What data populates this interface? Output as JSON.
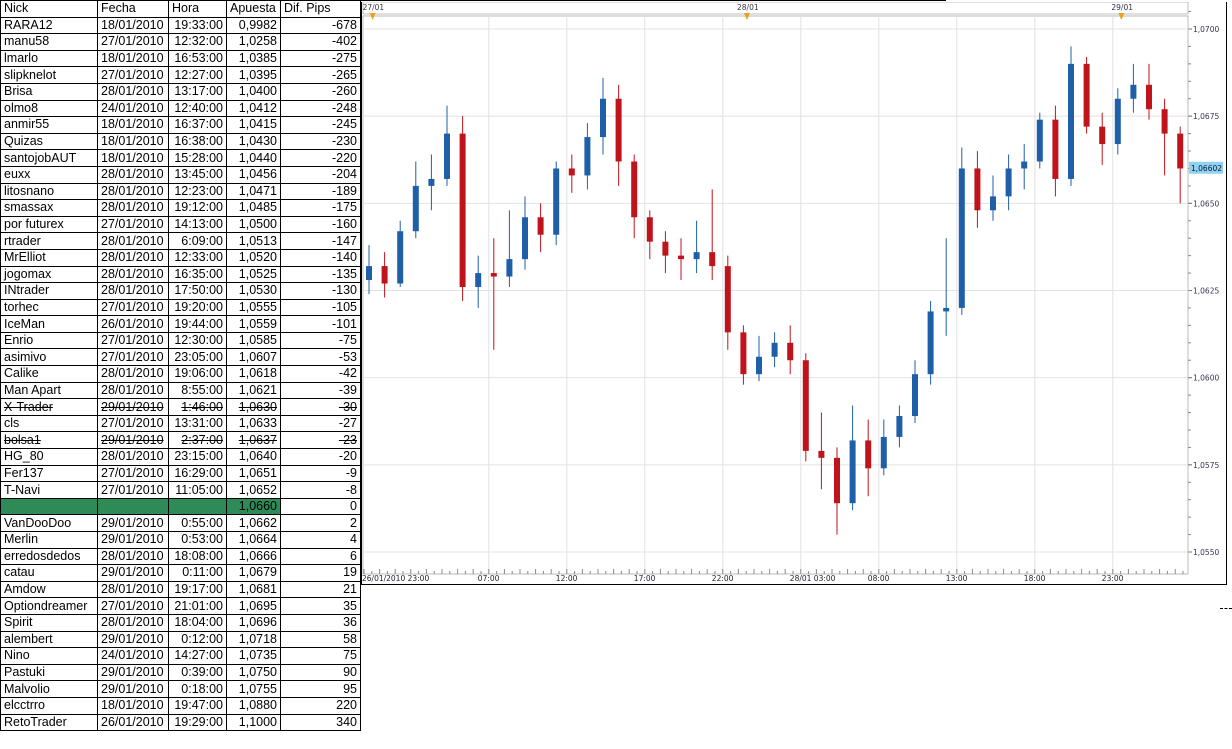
{
  "table": {
    "headers": [
      "Nick",
      "Fecha",
      "Hora",
      "Apuesta",
      "Dif. Pips"
    ],
    "rows": [
      [
        "RARA12",
        "18/01/2010",
        "19:33:00",
        "0,9982",
        "-678"
      ],
      [
        "manu58",
        "27/01/2010",
        "12:32:00",
        "1,0258",
        "-402"
      ],
      [
        "lmarlo",
        "18/01/2010",
        "16:53:00",
        "1,0385",
        "-275"
      ],
      [
        "slipknelot",
        "27/01/2010",
        "12:27:00",
        "1,0395",
        "-265"
      ],
      [
        "Brisa",
        "28/01/2010",
        "13:17:00",
        "1,0400",
        "-260"
      ],
      [
        "olmo8",
        "24/01/2010",
        "12:40:00",
        "1,0412",
        "-248"
      ],
      [
        "anmir55",
        "18/01/2010",
        "16:37:00",
        "1,0415",
        "-245"
      ],
      [
        "Quizas",
        "18/01/2010",
        "16:38:00",
        "1,0430",
        "-230"
      ],
      [
        "santojobAUT",
        "18/01/2010",
        "15:28:00",
        "1,0440",
        "-220"
      ],
      [
        "euxx",
        "28/01/2010",
        "13:45:00",
        "1,0456",
        "-204"
      ],
      [
        "litosnano",
        "28/01/2010",
        "12:23:00",
        "1,0471",
        "-189"
      ],
      [
        "smassax",
        "28/01/2010",
        "19:12:00",
        "1,0485",
        "-175"
      ],
      [
        "por futurex",
        "27/01/2010",
        "14:13:00",
        "1,0500",
        "-160"
      ],
      [
        "rtrader",
        "28/01/2010",
        "6:09:00",
        "1,0513",
        "-147"
      ],
      [
        "MrElliot",
        "28/01/2010",
        "12:33:00",
        "1,0520",
        "-140"
      ],
      [
        "jogomax",
        "28/01/2010",
        "16:35:00",
        "1,0525",
        "-135"
      ],
      [
        "INtrader",
        "28/01/2010",
        "17:50:00",
        "1,0530",
        "-130"
      ],
      [
        "torhec",
        "27/01/2010",
        "19:20:00",
        "1,0555",
        "-105"
      ],
      [
        "IceMan",
        "26/01/2010",
        "19:44:00",
        "1,0559",
        "-101"
      ],
      [
        "Enrio",
        "27/01/2010",
        "12:30:00",
        "1,0585",
        "-75"
      ],
      [
        "asimivo",
        "27/01/2010",
        "23:05:00",
        "1,0607",
        "-53"
      ],
      [
        "Calike",
        "28/01/2010",
        "19:06:00",
        "1,0618",
        "-42"
      ],
      [
        "Man Apart",
        "28/01/2010",
        "8:55:00",
        "1,0621",
        "-39"
      ],
      [
        "X-Trader",
        "29/01/2010",
        "1:46:00",
        "1,0630",
        "-30"
      ],
      [
        "cls",
        "27/01/2010",
        "13:31:00",
        "1,0633",
        "-27"
      ],
      [
        "bolsa1",
        "29/01/2010",
        "2:37:00",
        "1,0637",
        "-23"
      ],
      [
        "HG_80",
        "28/01/2010",
        "23:15:00",
        "1,0640",
        "-20"
      ],
      [
        "Fer137",
        "27/01/2010",
        "16:29:00",
        "1,0651",
        "-9"
      ],
      [
        "T-Navi",
        "27/01/2010",
        "11:05:00",
        "1,0652",
        "-8"
      ],
      [
        "",
        "",
        "",
        "1,0660",
        "0"
      ],
      [
        "VanDooDoo",
        "29/01/2010",
        "0:55:00",
        "1,0662",
        "2"
      ],
      [
        "Merlin",
        "29/01/2010",
        "0:53:00",
        "1,0664",
        "4"
      ],
      [
        "erredosdedos",
        "28/01/2010",
        "18:08:00",
        "1,0666",
        "6"
      ],
      [
        "catau",
        "29/01/2010",
        "0:11:00",
        "1,0679",
        "19"
      ],
      [
        "Amdow",
        "28/01/2010",
        "19:17:00",
        "1,0681",
        "21"
      ],
      [
        "Optiondreamer",
        "27/01/2010",
        "21:01:00",
        "1,0695",
        "35"
      ],
      [
        "Spirit",
        "28/01/2010",
        "18:04:00",
        "1,0696",
        "36"
      ],
      [
        "alembert",
        "29/01/2010",
        "0:12:00",
        "1,0718",
        "58"
      ],
      [
        "Nino",
        "24/01/2010",
        "14:27:00",
        "1,0735",
        "75"
      ],
      [
        "Pastuki",
        "29/01/2010",
        "0:39:00",
        "1,0750",
        "90"
      ],
      [
        "Malvolio",
        "29/01/2010",
        "0:18:00",
        "1,0755",
        "95"
      ],
      [
        "elcctrro",
        "18/01/2010",
        "19:47:00",
        "1,0880",
        "220"
      ],
      [
        "RetoTrader",
        "26/01/2010",
        "19:29:00",
        "1,1000",
        "340"
      ]
    ],
    "struck_rows": [
      23,
      25
    ],
    "current_row": 29,
    "dashed_after_row": 34,
    "current_color": "#2e8b57"
  },
  "chart_data": {
    "type": "candlestick",
    "title": "",
    "instrument_price_label": "1,06602",
    "last_price": 1.06602,
    "ylim": [
      1.0545,
      1.071
    ],
    "yticks": [
      1.055,
      1.0575,
      1.06,
      1.0625,
      1.065,
      1.0675,
      1.07
    ],
    "ytick_labels": [
      "1,0550",
      "1,0575",
      "1,0600",
      "1,0625",
      "1,0650",
      "1,0675",
      "1,0700"
    ],
    "xtick_labels": [
      "26/01/2010 23:00",
      "07:00",
      "12:00",
      "17:00",
      "22:00",
      "28/01 03:00",
      "08:00",
      "13:00",
      "18:00",
      "23:00"
    ],
    "xtick_hour_index": [
      0,
      8,
      13,
      18,
      23,
      28,
      33,
      38,
      43,
      48
    ],
    "day_markers": [
      {
        "label": "27/01",
        "hour_index": 1
      },
      {
        "label": "28/01",
        "hour_index": 25
      },
      {
        "label": "29/01",
        "hour_index": 49
      }
    ],
    "interval": "1h (approx.)",
    "first_open": 1.0628,
    "close": [
      1.0632,
      1.0627,
      1.0642,
      1.0655,
      1.0657,
      1.067,
      1.0626,
      1.063,
      1.0629,
      1.0634,
      1.0646,
      1.0641,
      1.066,
      1.0658,
      1.0669,
      1.068,
      1.0662,
      1.0646,
      1.0639,
      1.0635,
      1.0634,
      1.0636,
      1.0632,
      1.0613,
      1.0601,
      1.0606,
      1.061,
      1.0605,
      1.0579,
      1.0577,
      1.0564,
      1.0582,
      1.0574,
      1.0583,
      1.0589,
      1.0601,
      1.0619,
      1.062,
      1.066,
      1.0648,
      1.0652,
      1.066,
      1.0662,
      1.0674,
      1.0657,
      1.069,
      1.0672,
      1.0667,
      1.068,
      1.0684,
      1.0677,
      1.067,
      1.066
    ],
    "high": [
      1.0638,
      1.0636,
      1.0645,
      1.0662,
      1.0664,
      1.0678,
      1.0675,
      1.0635,
      1.064,
      1.0648,
      1.0652,
      1.065,
      1.0662,
      1.0664,
      1.0673,
      1.0686,
      1.0684,
      1.0664,
      1.0648,
      1.0642,
      1.064,
      1.0645,
      1.0654,
      1.0635,
      1.0615,
      1.0612,
      1.0613,
      1.0615,
      1.0607,
      1.059,
      1.058,
      1.0592,
      1.0588,
      1.0588,
      1.0592,
      1.0605,
      1.0622,
      1.064,
      1.0666,
      1.0665,
      1.0658,
      1.0664,
      1.0667,
      1.0676,
      1.0678,
      1.0695,
      1.0692,
      1.0676,
      1.0683,
      1.069,
      1.069,
      1.068,
      1.0672
    ],
    "low": [
      1.0624,
      1.0623,
      1.0626,
      1.064,
      1.0648,
      1.0655,
      1.0622,
      1.062,
      1.0608,
      1.0626,
      1.0631,
      1.0636,
      1.0638,
      1.0653,
      1.0654,
      1.0664,
      1.0655,
      1.064,
      1.0634,
      1.063,
      1.0628,
      1.063,
      1.0628,
      1.0608,
      1.0598,
      1.0599,
      1.0603,
      1.0601,
      1.0576,
      1.0568,
      1.0555,
      1.0562,
      1.0566,
      1.0572,
      1.058,
      1.0587,
      1.0598,
      1.0612,
      1.0618,
      1.0643,
      1.0645,
      1.0648,
      1.0654,
      1.066,
      1.0652,
      1.0655,
      1.067,
      1.0661,
      1.0664,
      1.0676,
      1.0674,
      1.0658,
      1.065
    ],
    "colors": {
      "up": "#1f5fa8",
      "down": "#c0141c",
      "grid": "#e2e2e2",
      "price_tag": "#8fd3f0",
      "marker": "#f0a020"
    },
    "grid": true
  }
}
